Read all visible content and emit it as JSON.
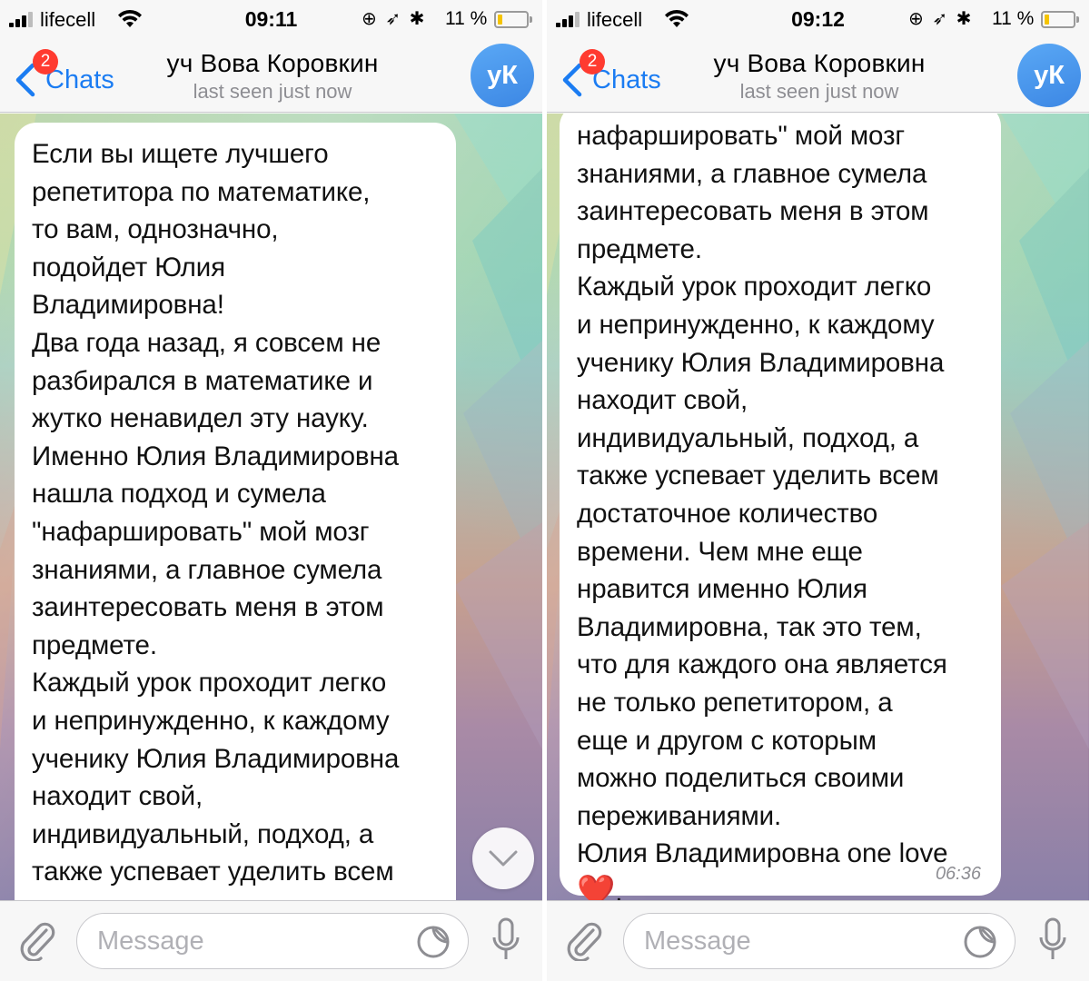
{
  "status_bar": {
    "carrier": "lifecell",
    "time_left": "09:11",
    "time_right": "09:12",
    "battery_text": "11 %",
    "battery_level": 0.11,
    "status_icons": "⊕ ➶ ✱"
  },
  "nav": {
    "back_label": "Chats",
    "unread_badge": "2",
    "chat_title": "уч Вова Коровкин",
    "subtitle": "last seen just now",
    "avatar_initials": "уК"
  },
  "left_message": {
    "lines": [
      "Если вы ищете лучшего",
      "репетитора по математике,",
      "то вам, однозначно,",
      "подойдет Юлия",
      "Владимировна!",
      "Два года назад, я совсем не",
      "разбирался в математике и",
      "жутко ненавидел эту науку.",
      "Именно Юлия Владимировна",
      "нашла подход и сумела",
      "\"нафаршировать\" мой мозг",
      "знаниями, а главное сумела",
      "заинтересовать меня в этом",
      "предмете.",
      "Каждый урок проходит легко",
      "и непринужденно, к каждому",
      "ученику Юлия Владимировна",
      "находит свой,",
      "индивидуальный, подход, а",
      "также успевает уделить всем"
    ]
  },
  "right_message": {
    "lines": [
      "нафаршировать\" мой мозг",
      "знаниями, а главное сумела",
      "заинтересовать меня в этом",
      "предмете.",
      "Каждый урок проходит легко",
      "и непринужденно, к каждому",
      "ученику Юлия Владимировна",
      "находит свой,",
      "индивидуальный, подход, а",
      "также успевает уделить всем",
      "достаточное количество",
      "времени. Чем мне еще",
      "нравится именно Юлия",
      "Владимировна, так это тем,",
      "что для каждого она является",
      "не только репетитором, а",
      "еще и другом с которым",
      "можно поделиться своими",
      "переживаниями.",
      "Юлия Владимировна one love"
    ],
    "last_line_emoji": "❤️",
    "last_line_suffix": ".",
    "time": "06:36"
  },
  "input": {
    "placeholder": "Message"
  },
  "icons": {
    "back": "chevron-left-icon",
    "attach": "paperclip-icon",
    "sticker": "sticker-icon",
    "mic": "microphone-icon",
    "scroll_down": "chevron-down-icon"
  },
  "colors": {
    "accent": "#1b7cf2",
    "badge": "#ff3b30",
    "avatar": "#4a95ea",
    "timestamp": "#8e8e93"
  }
}
